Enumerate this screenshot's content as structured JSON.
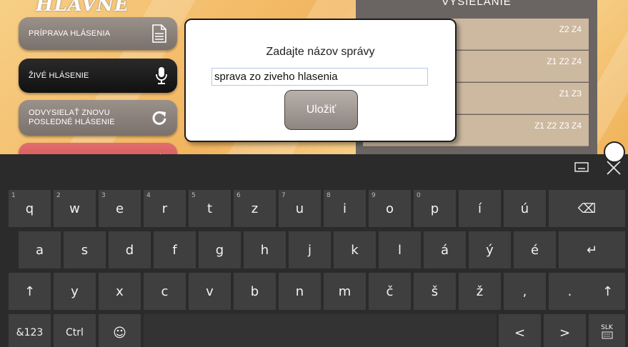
{
  "app": {
    "heading": "HLAVNÉ MENU",
    "buttons": [
      {
        "label": "PRÍPRAVA HLÁSENIA",
        "icon": "document-icon"
      },
      {
        "label": "ŽIVÉ HLÁSENIE",
        "icon": "microphone-icon"
      },
      {
        "label": "ODVYSIELAŤ ZNOVU\nPOSLEDNÉ HLÁSENIE",
        "icon": "replay-icon"
      },
      {
        "label": "",
        "icon": "speaker-icon"
      }
    ],
    "right_panel": {
      "heading": "VYSIELANIE",
      "rows": [
        "Z2 Z4",
        "Z1 Z2 Z4",
        "Z1 Z3",
        "Z1 Z2 Z3 Z4"
      ]
    }
  },
  "dialog": {
    "title": "Zadajte názov správy",
    "input_value": "sprava zo ziveho hlasenia",
    "save_label": "Uložiť"
  },
  "keyboard": {
    "layout_label": "SLK",
    "toolbar": [
      "keyboard-dock-icon",
      "close-icon"
    ],
    "rows": [
      [
        {
          "k": "q",
          "h": "1"
        },
        {
          "k": "w",
          "h": "2"
        },
        {
          "k": "e",
          "h": "3"
        },
        {
          "k": "r",
          "h": "4"
        },
        {
          "k": "t",
          "h": "5"
        },
        {
          "k": "z",
          "h": "6"
        },
        {
          "k": "u",
          "h": "7"
        },
        {
          "k": "i",
          "h": "8"
        },
        {
          "k": "o",
          "h": "9"
        },
        {
          "k": "p",
          "h": "0"
        },
        {
          "k": "í"
        },
        {
          "k": "ú"
        },
        {
          "k": "⌫",
          "name": "backspace-key"
        }
      ],
      [
        {
          "k": "a"
        },
        {
          "k": "s"
        },
        {
          "k": "d"
        },
        {
          "k": "f"
        },
        {
          "k": "g"
        },
        {
          "k": "h"
        },
        {
          "k": "j"
        },
        {
          "k": "k"
        },
        {
          "k": "l"
        },
        {
          "k": "á"
        },
        {
          "k": "ý"
        },
        {
          "k": "é"
        },
        {
          "k": "↵",
          "name": "enter-key"
        }
      ],
      [
        {
          "k": "↑",
          "name": "shift-key"
        },
        {
          "k": "y"
        },
        {
          "k": "x"
        },
        {
          "k": "c"
        },
        {
          "k": "v"
        },
        {
          "k": "b"
        },
        {
          "k": "n"
        },
        {
          "k": "m"
        },
        {
          "k": "č"
        },
        {
          "k": "š"
        },
        {
          "k": "ž"
        },
        {
          "k": ","
        },
        {
          "k": "."
        },
        {
          "k": "↑",
          "name": "shift-key-right"
        }
      ],
      [
        {
          "k": "&123",
          "name": "symbols-key"
        },
        {
          "k": "Ctrl",
          "name": "ctrl-key"
        },
        {
          "k": "☺",
          "name": "emoji-key"
        },
        {
          "k": "",
          "name": "space-key"
        },
        {
          "k": "<",
          "name": "left-arrow-key"
        },
        {
          "k": ">",
          "name": "right-arrow-key"
        },
        {
          "k": "SLK",
          "name": "language-key"
        }
      ]
    ]
  }
}
